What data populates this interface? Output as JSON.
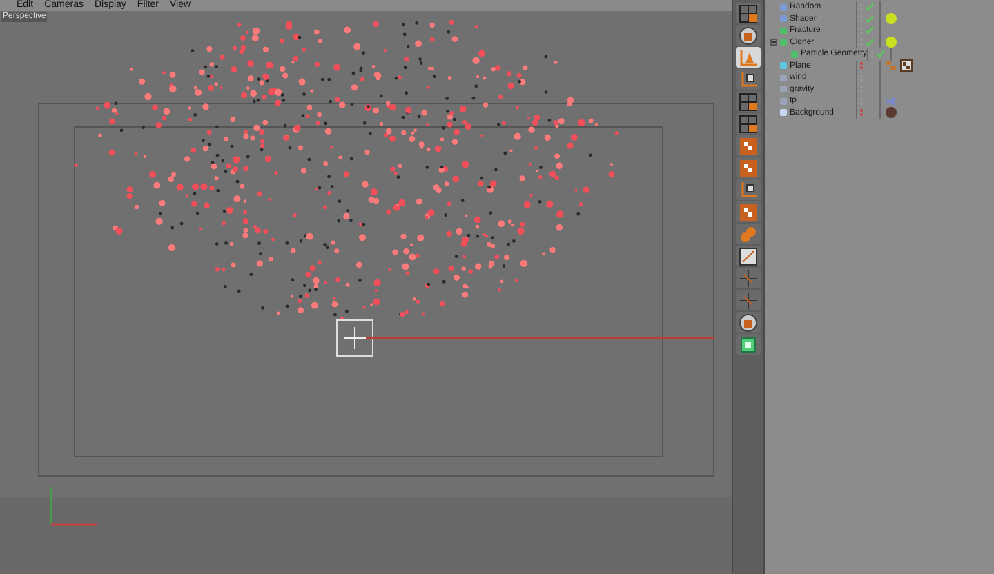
{
  "menu": [
    "Edit",
    "Cameras",
    "Display",
    "Filter",
    "View"
  ],
  "viewport": {
    "label": "Perspective"
  },
  "toolbar": [
    {
      "kind": "grid",
      "selected": false
    },
    {
      "kind": "figure",
      "selected": false
    },
    {
      "kind": "cone",
      "selected": true
    },
    {
      "kind": "axis",
      "selected": false
    },
    {
      "kind": "grid",
      "selected": false
    },
    {
      "kind": "grid",
      "selected": false
    },
    {
      "kind": "checker",
      "selected": false
    },
    {
      "kind": "checker",
      "selected": false
    },
    {
      "kind": "axis",
      "selected": false
    },
    {
      "kind": "checker",
      "selected": false
    },
    {
      "kind": "blob",
      "selected": false
    },
    {
      "kind": "graph",
      "selected": false
    },
    {
      "kind": "cross",
      "selected": false
    },
    {
      "kind": "cross",
      "selected": false
    },
    {
      "kind": "figure",
      "selected": false
    },
    {
      "kind": "cube",
      "selected": false
    }
  ],
  "objects": [
    {
      "name": "Random",
      "kind": "effector",
      "visibility_off": false,
      "enabled": true
    },
    {
      "name": "Shader",
      "kind": "effector",
      "visibility_off": false,
      "enabled": true,
      "tags": [
        {
          "kind": "sphere"
        }
      ]
    },
    {
      "name": "Fracture",
      "kind": "generator",
      "visibility_off": false,
      "enabled": true
    },
    {
      "name": "Cloner",
      "kind": "generator",
      "visibility_off": false,
      "enabled": true,
      "tags": [
        {
          "kind": "sphere"
        }
      ],
      "expanded": true,
      "children": [
        {
          "name": "Particle Geometry",
          "kind": "generator",
          "visibility_off": false,
          "enabled": true
        }
      ]
    },
    {
      "name": "Plane",
      "kind": "primitive",
      "visibility_off": true,
      "enabled": false,
      "tags": [
        {
          "kind": "blocks"
        },
        {
          "kind": "checker"
        }
      ]
    },
    {
      "name": "wind",
      "kind": "modifier",
      "visibility_off": false,
      "enabled": false
    },
    {
      "name": "gravity",
      "kind": "modifier",
      "visibility_off": false,
      "enabled": false
    },
    {
      "name": "tp",
      "kind": "modifier",
      "visibility_off": false,
      "enabled": false,
      "tags": [
        {
          "kind": "speaker"
        }
      ]
    },
    {
      "name": "Background",
      "kind": "environment",
      "visibility_off": true,
      "enabled": false,
      "tags": [
        {
          "kind": "dark-sphere"
        }
      ]
    }
  ]
}
